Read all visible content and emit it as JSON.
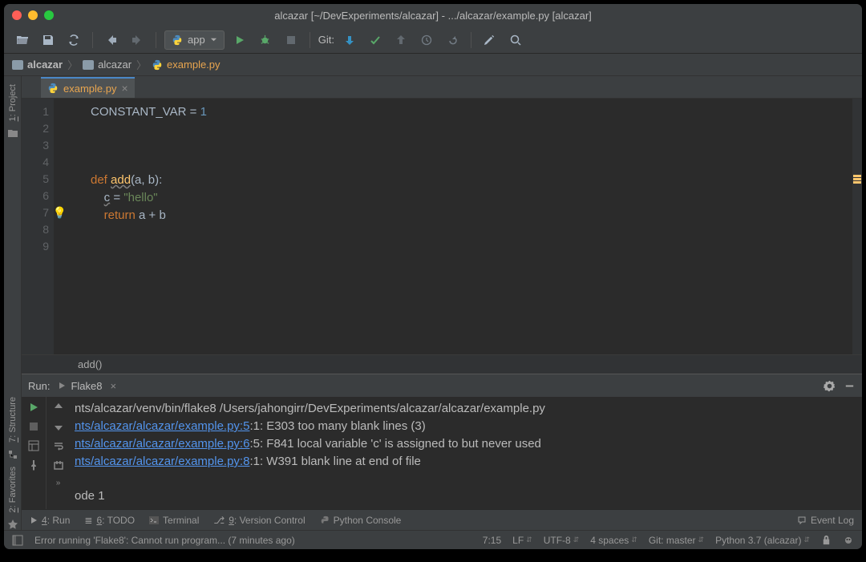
{
  "title": "alcazar [~/DevExperiments/alcazar] - .../alcazar/example.py [alcazar]",
  "runConfig": "app",
  "gitLabel": "Git:",
  "breadcrumb": {
    "root": "alcazar",
    "folder": "alcazar",
    "file": "example.py"
  },
  "leftGutter": {
    "project": "1: Project",
    "structure": "7: Structure",
    "favorites": "2: Favorites"
  },
  "tabs": {
    "active": "example.py"
  },
  "code": {
    "lines": [
      "1",
      "2",
      "3",
      "4",
      "5",
      "6",
      "7",
      "8",
      "9"
    ],
    "constant_name": "CONSTANT_VAR",
    "eq": " = ",
    "constant_val": "1",
    "def": "def ",
    "fn": "add",
    "params": "(a, b):",
    "indent": "    ",
    "cvar": "c",
    "assign": " = ",
    "hello": "\"hello\"",
    "return": "return ",
    "expr": "a + b"
  },
  "bc2": "add()",
  "run": {
    "label": "Run:",
    "tab": "Flake8",
    "cmd": "nts/alcazar/venv/bin/flake8 /Users/jahongirr/DevExperiments/alcazar/alcazar/example.py",
    "l1_link": "nts/alcazar/alcazar/example.py:5",
    "l1_rest": ":1: E303 too many blank lines (3)",
    "l2_link": "nts/alcazar/alcazar/example.py:6",
    "l2_rest": ":5: F841 local variable 'c' is assigned to but never used",
    "l3_link": "nts/alcazar/alcazar/example.py:8",
    "l3_rest": ":1: W391 blank line at end of file",
    "exit": "ode 1"
  },
  "bottom": {
    "run": "4: Run",
    "todo": "6: TODO",
    "terminal": "Terminal",
    "vcs": "9: Version Control",
    "python": "Python Console",
    "eventlog": "Event Log"
  },
  "status": {
    "msg": "Error running 'Flake8': Cannot run program... (7 minutes ago)",
    "cursor": "7:15",
    "lineend": "LF",
    "enc": "UTF-8",
    "indent": "4 spaces",
    "git": "Git: master",
    "python": "Python 3.7 (alcazar)"
  }
}
